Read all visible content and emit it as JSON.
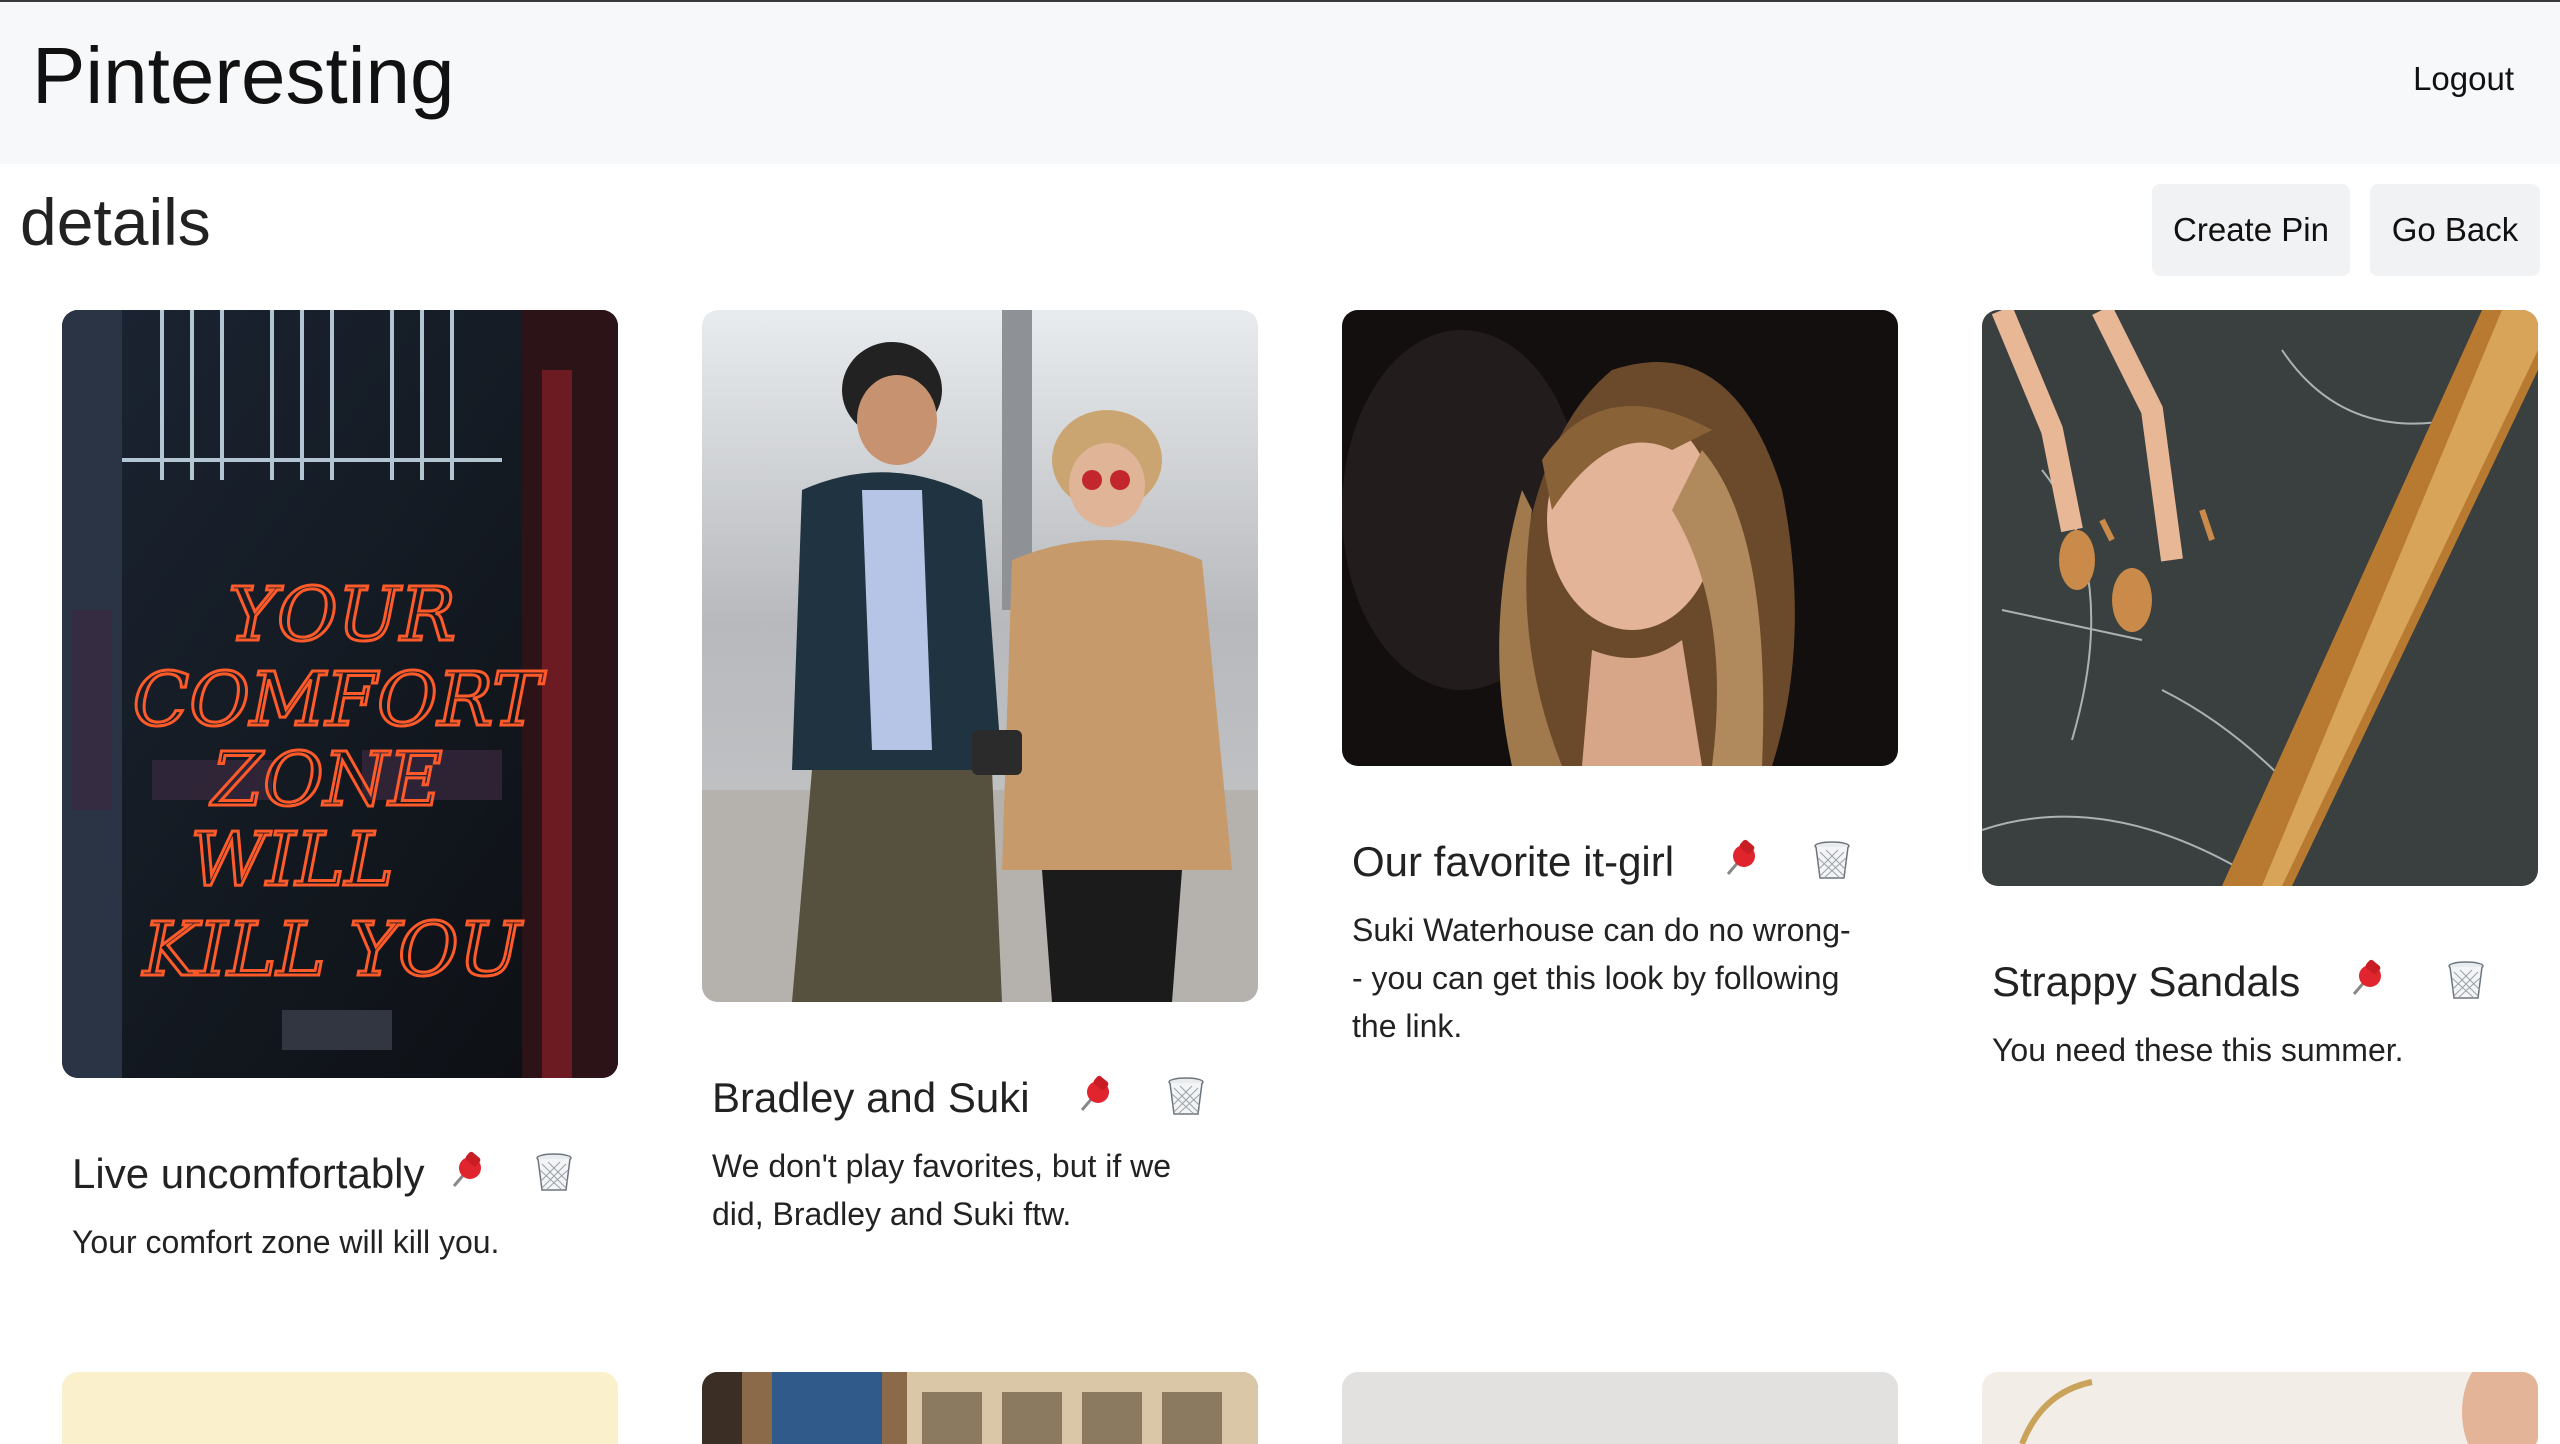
{
  "brand": "Pinteresting",
  "nav": {
    "logout": "Logout"
  },
  "page": {
    "title": "details"
  },
  "actions": {
    "create_pin": "Create Pin",
    "go_back": "Go Back"
  },
  "pins": [
    {
      "title": "Live uncomfortably",
      "description": "Your comfort zone will kill you.",
      "image_text": "YOUR COMFORT ZONE WILL KILL YOU",
      "pin_icon": "pushpin-icon",
      "delete_icon": "trash-icon"
    },
    {
      "title": "Bradley and Suki",
      "description": "We don't play favorites, but if we did, Bradley and Suki ftw.",
      "pin_icon": "pushpin-icon",
      "delete_icon": "trash-icon"
    },
    {
      "title": "Our favorite it-girl",
      "description": "Suki Waterhouse can do no wrong-- you can get this look by following the link.",
      "pin_icon": "pushpin-icon",
      "delete_icon": "trash-icon"
    },
    {
      "title": "Strappy Sandals",
      "description": "You need these this summer.",
      "pin_icon": "pushpin-icon",
      "delete_icon": "trash-icon"
    }
  ]
}
